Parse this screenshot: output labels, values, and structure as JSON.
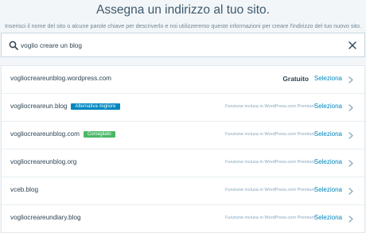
{
  "header": {
    "title": "Assegna un indirizzo al tuo sito.",
    "subtitle": "Inserisci il nome del sito o alcune parole chiave per descriverlo e noi utilizzeremo queste informazioni per creare l'indirizzo del tuo nuovo sito."
  },
  "search": {
    "value": "voglio creare un blog",
    "icon": "search-icon",
    "clear_icon": "close-icon"
  },
  "colors": {
    "accent": "#0087be",
    "badge_alternative": "#0087be",
    "badge_recommended": "#4ab866"
  },
  "domains": [
    {
      "name": "vogliocreareunblog.wordpress.com",
      "badge": "",
      "price": "Gratuito",
      "note": "",
      "action": "Seleziona"
    },
    {
      "name": "vogliocreareun.blog",
      "badge": "Alternativa migliore",
      "price": "",
      "note": "Funzione inclusa in WordPress.com Premium",
      "action": "Seleziona"
    },
    {
      "name": "vogliocreareunblog.com",
      "badge": "Consigliato",
      "price": "",
      "note": "Funzione inclusa in WordPress.com Premium",
      "action": "Seleziona"
    },
    {
      "name": "vogliocreareunblog.org",
      "badge": "",
      "price": "",
      "note": "Funzione inclusa in WordPress.com Premium",
      "action": "Seleziona"
    },
    {
      "name": "vceb.blog",
      "badge": "",
      "price": "",
      "note": "Funzione inclusa in WordPress.com Premium",
      "action": "Seleziona"
    },
    {
      "name": "vogliocreareundiary.blog",
      "badge": "",
      "price": "",
      "note": "Funzione inclusa in WordPress.com Premium",
      "action": "Seleziona"
    }
  ]
}
